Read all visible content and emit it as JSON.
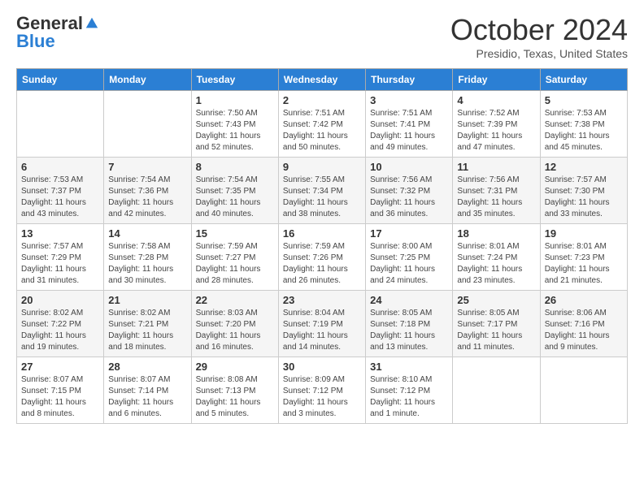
{
  "header": {
    "logo_general": "General",
    "logo_blue": "Blue",
    "title": "October 2024",
    "location": "Presidio, Texas, United States"
  },
  "days_of_week": [
    "Sunday",
    "Monday",
    "Tuesday",
    "Wednesday",
    "Thursday",
    "Friday",
    "Saturday"
  ],
  "weeks": [
    [
      {
        "day": "",
        "info": ""
      },
      {
        "day": "",
        "info": ""
      },
      {
        "day": "1",
        "info": "Sunrise: 7:50 AM\nSunset: 7:43 PM\nDaylight: 11 hours\nand 52 minutes."
      },
      {
        "day": "2",
        "info": "Sunrise: 7:51 AM\nSunset: 7:42 PM\nDaylight: 11 hours\nand 50 minutes."
      },
      {
        "day": "3",
        "info": "Sunrise: 7:51 AM\nSunset: 7:41 PM\nDaylight: 11 hours\nand 49 minutes."
      },
      {
        "day": "4",
        "info": "Sunrise: 7:52 AM\nSunset: 7:39 PM\nDaylight: 11 hours\nand 47 minutes."
      },
      {
        "day": "5",
        "info": "Sunrise: 7:53 AM\nSunset: 7:38 PM\nDaylight: 11 hours\nand 45 minutes."
      }
    ],
    [
      {
        "day": "6",
        "info": "Sunrise: 7:53 AM\nSunset: 7:37 PM\nDaylight: 11 hours\nand 43 minutes."
      },
      {
        "day": "7",
        "info": "Sunrise: 7:54 AM\nSunset: 7:36 PM\nDaylight: 11 hours\nand 42 minutes."
      },
      {
        "day": "8",
        "info": "Sunrise: 7:54 AM\nSunset: 7:35 PM\nDaylight: 11 hours\nand 40 minutes."
      },
      {
        "day": "9",
        "info": "Sunrise: 7:55 AM\nSunset: 7:34 PM\nDaylight: 11 hours\nand 38 minutes."
      },
      {
        "day": "10",
        "info": "Sunrise: 7:56 AM\nSunset: 7:32 PM\nDaylight: 11 hours\nand 36 minutes."
      },
      {
        "day": "11",
        "info": "Sunrise: 7:56 AM\nSunset: 7:31 PM\nDaylight: 11 hours\nand 35 minutes."
      },
      {
        "day": "12",
        "info": "Sunrise: 7:57 AM\nSunset: 7:30 PM\nDaylight: 11 hours\nand 33 minutes."
      }
    ],
    [
      {
        "day": "13",
        "info": "Sunrise: 7:57 AM\nSunset: 7:29 PM\nDaylight: 11 hours\nand 31 minutes."
      },
      {
        "day": "14",
        "info": "Sunrise: 7:58 AM\nSunset: 7:28 PM\nDaylight: 11 hours\nand 30 minutes."
      },
      {
        "day": "15",
        "info": "Sunrise: 7:59 AM\nSunset: 7:27 PM\nDaylight: 11 hours\nand 28 minutes."
      },
      {
        "day": "16",
        "info": "Sunrise: 7:59 AM\nSunset: 7:26 PM\nDaylight: 11 hours\nand 26 minutes."
      },
      {
        "day": "17",
        "info": "Sunrise: 8:00 AM\nSunset: 7:25 PM\nDaylight: 11 hours\nand 24 minutes."
      },
      {
        "day": "18",
        "info": "Sunrise: 8:01 AM\nSunset: 7:24 PM\nDaylight: 11 hours\nand 23 minutes."
      },
      {
        "day": "19",
        "info": "Sunrise: 8:01 AM\nSunset: 7:23 PM\nDaylight: 11 hours\nand 21 minutes."
      }
    ],
    [
      {
        "day": "20",
        "info": "Sunrise: 8:02 AM\nSunset: 7:22 PM\nDaylight: 11 hours\nand 19 minutes."
      },
      {
        "day": "21",
        "info": "Sunrise: 8:02 AM\nSunset: 7:21 PM\nDaylight: 11 hours\nand 18 minutes."
      },
      {
        "day": "22",
        "info": "Sunrise: 8:03 AM\nSunset: 7:20 PM\nDaylight: 11 hours\nand 16 minutes."
      },
      {
        "day": "23",
        "info": "Sunrise: 8:04 AM\nSunset: 7:19 PM\nDaylight: 11 hours\nand 14 minutes."
      },
      {
        "day": "24",
        "info": "Sunrise: 8:05 AM\nSunset: 7:18 PM\nDaylight: 11 hours\nand 13 minutes."
      },
      {
        "day": "25",
        "info": "Sunrise: 8:05 AM\nSunset: 7:17 PM\nDaylight: 11 hours\nand 11 minutes."
      },
      {
        "day": "26",
        "info": "Sunrise: 8:06 AM\nSunset: 7:16 PM\nDaylight: 11 hours\nand 9 minutes."
      }
    ],
    [
      {
        "day": "27",
        "info": "Sunrise: 8:07 AM\nSunset: 7:15 PM\nDaylight: 11 hours\nand 8 minutes."
      },
      {
        "day": "28",
        "info": "Sunrise: 8:07 AM\nSunset: 7:14 PM\nDaylight: 11 hours\nand 6 minutes."
      },
      {
        "day": "29",
        "info": "Sunrise: 8:08 AM\nSunset: 7:13 PM\nDaylight: 11 hours\nand 5 minutes."
      },
      {
        "day": "30",
        "info": "Sunrise: 8:09 AM\nSunset: 7:12 PM\nDaylight: 11 hours\nand 3 minutes."
      },
      {
        "day": "31",
        "info": "Sunrise: 8:10 AM\nSunset: 7:12 PM\nDaylight: 11 hours\nand 1 minute."
      },
      {
        "day": "",
        "info": ""
      },
      {
        "day": "",
        "info": ""
      }
    ]
  ]
}
